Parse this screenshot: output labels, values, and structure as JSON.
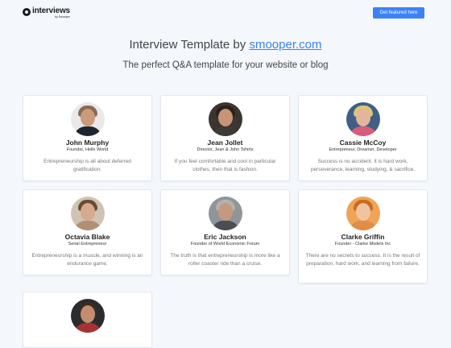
{
  "header": {
    "logo_text": "interviews",
    "logo_sub": "by Smooper",
    "featured_button": "Get featured here"
  },
  "hero": {
    "title_prefix": "Interview Template by ",
    "title_link": "smooper.com",
    "subtitle": "The perfect Q&A template for your website or blog"
  },
  "cards": [
    {
      "name": "John Murphy",
      "role": "Founder, Hello World",
      "quote": "Entrepreneurship is all about deferred gratification.",
      "colors": {
        "bg": "#e9e9e9",
        "face": "#c99a7c",
        "hair": "#8a6a52",
        "shoulders": "#1f2530"
      }
    },
    {
      "name": "Jean Jollet",
      "role": "Director, Jean & John Tshirts",
      "quote": "If you feel comfortable and cool in particular clothes, then that is fashion.",
      "colors": {
        "bg": "#3a3530",
        "face": "#c79475",
        "hair": "#2a211b",
        "shoulders": "#3d3935"
      }
    },
    {
      "name": "Cassie McCoy",
      "role": "Entrepreneur, Dreamer, Developer",
      "quote": "Success is no accident. It is hard work, perseverance, learning, studying, & sacrifice.",
      "colors": {
        "bg": "#3f5f86",
        "face": "#e2b69a",
        "hair": "#e0c27a",
        "shoulders": "#d95c7a"
      }
    },
    {
      "name": "Octavia Blake",
      "role": "Serial Entrepreneur",
      "quote": "Entrepreneurship is a muscle, and winning is an endurance game.",
      "colors": {
        "bg": "#cfc4b4",
        "face": "#d8aa8d",
        "hair": "#6b4a32",
        "shoulders": "#b08f74"
      }
    },
    {
      "name": "Eric Jackson",
      "role": "Founder of World Economic Forum",
      "quote": "The truth is that entrepreneurship is more like a roller coaster ride than a cruise.",
      "colors": {
        "bg": "#8f9599",
        "face": "#c39a80",
        "hair": "#b7b1aa",
        "shoulders": "#4a4f55"
      }
    },
    {
      "name": "Clarke Griffin",
      "role": "Founder - Clarke Models Inc",
      "quote": "There are no secrets to success. It is the result of preparation, hard work, and learning from failure.",
      "colors": {
        "bg": "#f0a455",
        "face": "#f1c4a0",
        "hair": "#c96a25",
        "shoulders": "#e08d45"
      }
    },
    {
      "name": "",
      "role": "",
      "quote": "",
      "colors": {
        "bg": "#2c2c30",
        "face": "#c48d70",
        "hair": "#3a2a22",
        "shoulders": "#a83232"
      }
    }
  ]
}
